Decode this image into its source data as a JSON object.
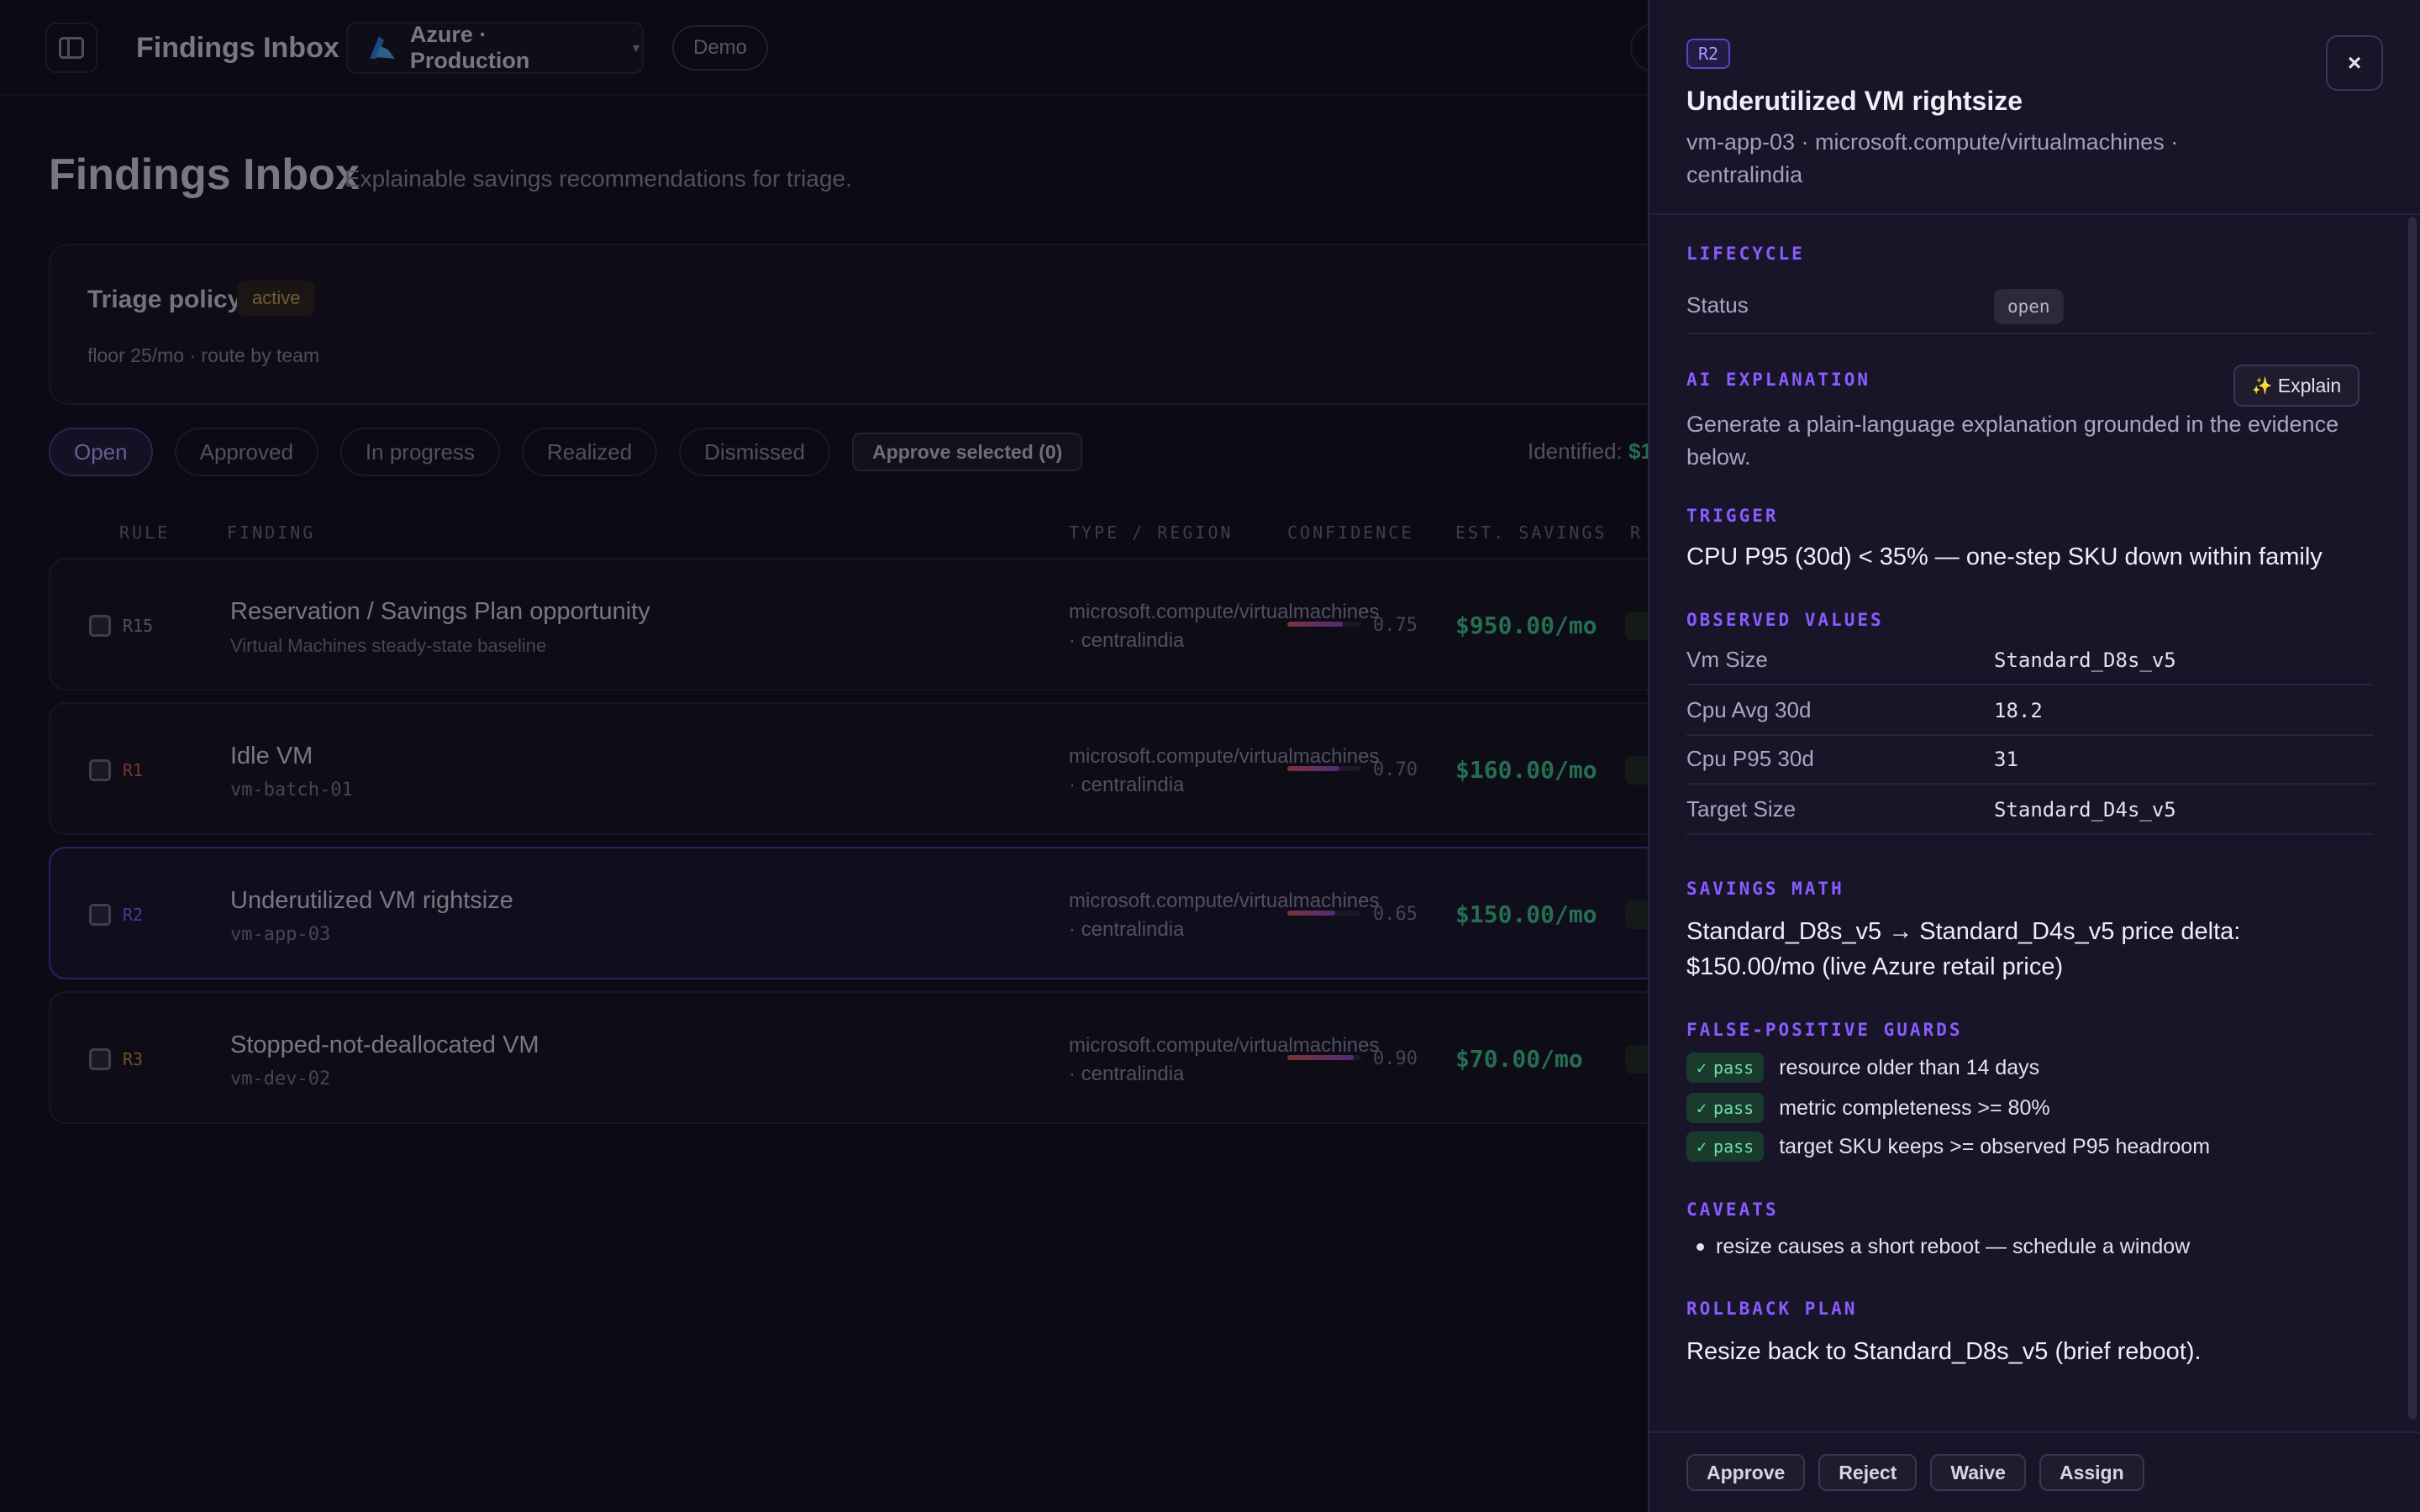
{
  "topbar": {
    "title": "Findings Inbox",
    "environment": "Azure · Production",
    "demo_badge": "Demo"
  },
  "page": {
    "title": "Findings Inbox",
    "subtitle": "Explainable savings recommendations for triage."
  },
  "policy": {
    "title": "Triage policy",
    "badge": "active",
    "meta": "floor 25/mo · route by team"
  },
  "tabs": [
    {
      "label": "Open",
      "active": true
    },
    {
      "label": "Approved",
      "active": false
    },
    {
      "label": "In progress",
      "active": false
    },
    {
      "label": "Realized",
      "active": false
    },
    {
      "label": "Dismissed",
      "active": false
    }
  ],
  "approve_selected_label": "Approve selected (0)",
  "identified": {
    "label": "Identified:",
    "value": "$1"
  },
  "table": {
    "headers": [
      "RULE",
      "FINDING",
      "TYPE / REGION",
      "CONFIDENCE",
      "EST. SAVINGS",
      "R"
    ],
    "rows": [
      {
        "rule": "R15",
        "rule_color": "#8f8aa6",
        "title": "Reservation / Savings Plan opportunity",
        "sub": "Virtual Machines steady-state baseline",
        "sub_mono": false,
        "type": "microsoft.compute/virtualmachines",
        "region": "· centralindia",
        "confidence": 0.75,
        "confidence_label": "0.75",
        "savings": "$950.00/mo",
        "selected": false
      },
      {
        "rule": "R1",
        "rule_color": "#d85a50",
        "title": "Idle VM",
        "sub": "vm-batch-01",
        "sub_mono": true,
        "type": "microsoft.compute/virtualmachines",
        "region": "· centralindia",
        "confidence": 0.7,
        "confidence_label": "0.70",
        "savings": "$160.00/mo",
        "selected": false
      },
      {
        "rule": "R2",
        "rule_color": "#8a5cff",
        "title": "Underutilized VM rightsize",
        "sub": "vm-app-03",
        "sub_mono": true,
        "type": "microsoft.compute/virtualmachines",
        "region": "· centralindia",
        "confidence": 0.65,
        "confidence_label": "0.65",
        "savings": "$150.00/mo",
        "selected": true
      },
      {
        "rule": "R3",
        "rule_color": "#c98a3a",
        "title": "Stopped-not-deallocated VM",
        "sub": "vm-dev-02",
        "sub_mono": true,
        "type": "microsoft.compute/virtualmachines",
        "region": "· centralindia",
        "confidence": 0.9,
        "confidence_label": "0.90",
        "savings": "$70.00/mo",
        "selected": false
      }
    ]
  },
  "drawer": {
    "rule_chip": "R2",
    "title": "Underutilized VM rightsize",
    "subtitle": "vm-app-03 · microsoft.compute/virtualmachines · centralindia",
    "close_label": "×",
    "lifecycle": {
      "label": "LIFECYCLE",
      "status_label": "Status",
      "status_value": "open"
    },
    "ai": {
      "label": "AI EXPLANATION",
      "button": "Explain",
      "text": "Generate a plain-language explanation grounded in the evidence below."
    },
    "trigger": {
      "label": "TRIGGER",
      "text": "CPU P95 (30d) < 35% — one-step SKU down within family"
    },
    "observed": {
      "label": "OBSERVED VALUES",
      "rows": [
        {
          "key": "Vm Size",
          "value": "Standard_D8s_v5"
        },
        {
          "key": "Cpu Avg 30d",
          "value": "18.2"
        },
        {
          "key": "Cpu P95 30d",
          "value": "31"
        },
        {
          "key": "Target Size",
          "value": "Standard_D4s_v5"
        }
      ]
    },
    "savings_math": {
      "label": "SAVINGS MATH",
      "text": "Standard_D8s_v5 → Standard_D4s_v5 price delta: $150.00/mo (live Azure retail price)"
    },
    "guards": {
      "label": "FALSE-POSITIVE GUARDS",
      "items": [
        {
          "status": "pass",
          "text": "resource older than 14 days"
        },
        {
          "status": "pass",
          "text": "metric completeness >= 80%"
        },
        {
          "status": "pass",
          "text": "target SKU keeps >= observed P95 headroom"
        }
      ]
    },
    "caveats": {
      "label": "CAVEATS",
      "items": [
        "resize causes a short reboot — schedule a window"
      ]
    },
    "rollback": {
      "label": "ROLLBACK PLAN",
      "text": "Resize back to Standard_D8s_v5 (brief reboot)."
    },
    "footer": {
      "approve": "Approve",
      "reject": "Reject",
      "waive": "Waive",
      "assign": "Assign"
    }
  },
  "colors": {
    "accent": "#8a5cff",
    "savings_green": "#3dc48a",
    "background": "#0f0d1a",
    "drawer_bg": "#181528"
  }
}
